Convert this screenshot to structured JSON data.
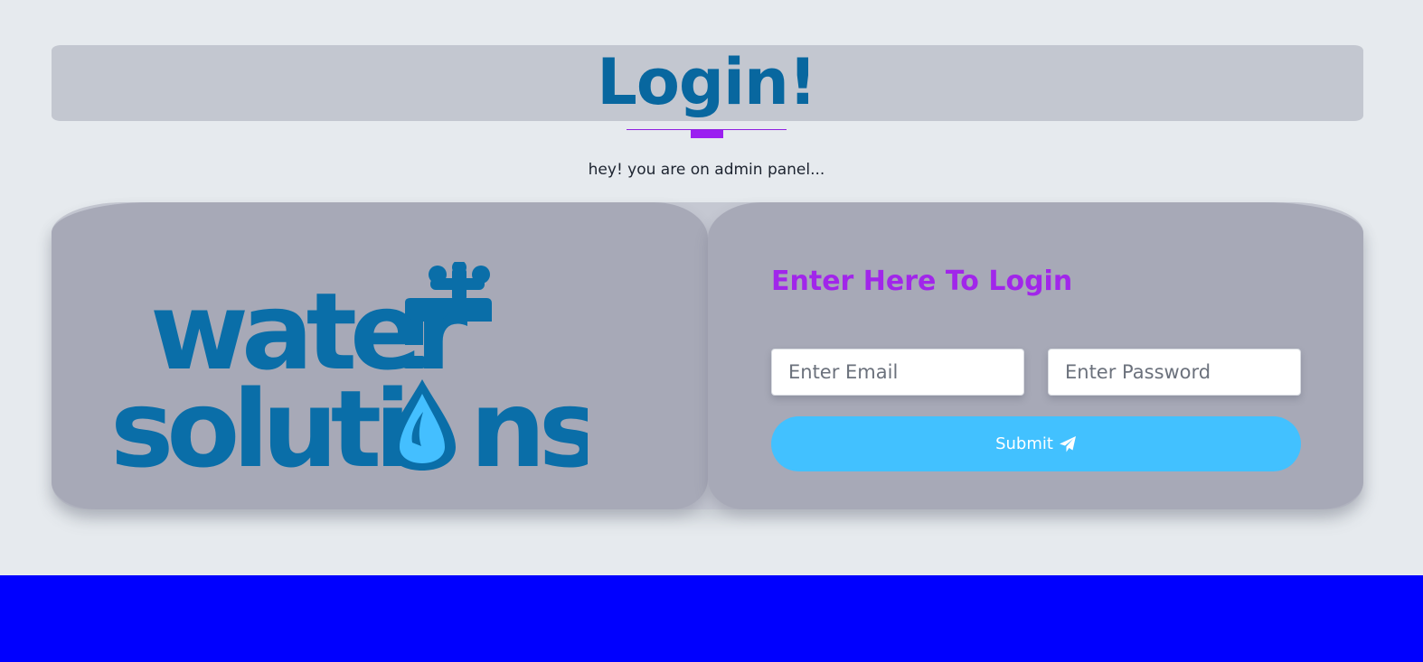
{
  "header": {
    "title": "Login!",
    "subtitle": "hey! you are on admin panel..."
  },
  "logo": {
    "word_top": "water",
    "word_bottom": "solutions",
    "color_primary": "#0a6ea8",
    "color_drop": "#44bfff"
  },
  "form": {
    "heading": "Enter Here To Login",
    "email_placeholder": "Enter Email",
    "password_placeholder": "Enter Password",
    "submit_label": "Submit",
    "submit_icon": "paper-plane-icon"
  },
  "colors": {
    "background": "#e6eaee",
    "title": "#08679f",
    "accent_purple": "#a126ea",
    "panel": "#a7a9b7",
    "submit": "#42c1ff",
    "footer": "#0000ff"
  }
}
